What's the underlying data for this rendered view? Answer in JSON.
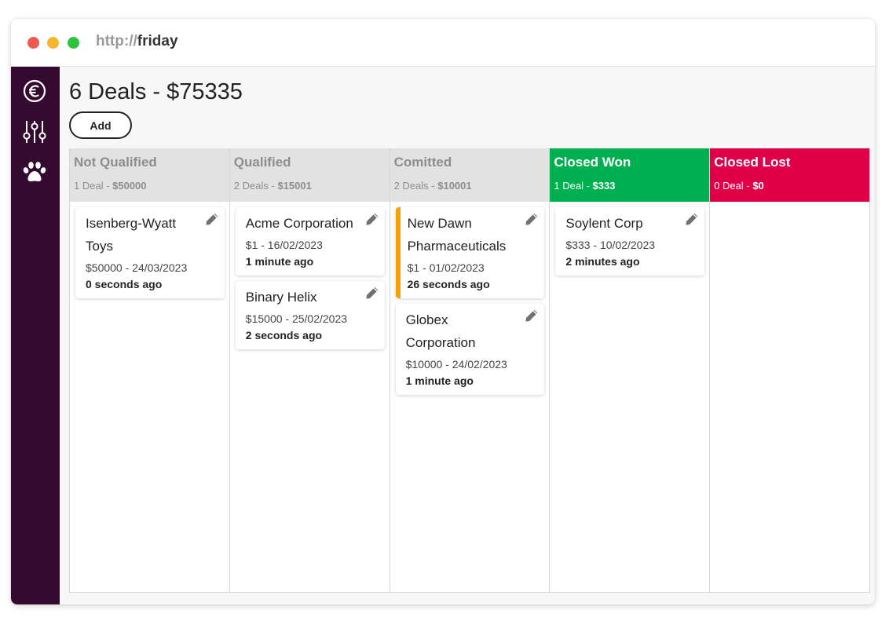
{
  "browser": {
    "url_protocol": "http://",
    "url_host": "friday"
  },
  "sidebar": {
    "items": [
      {
        "icon": "euro-icon"
      },
      {
        "icon": "sliders-icon"
      },
      {
        "icon": "paw-icon"
      }
    ]
  },
  "header": {
    "title": "6 Deals - $75335",
    "add_label": "Add"
  },
  "colors": {
    "won": "#00b050",
    "lost": "#e0004a",
    "flag": "#f5a300",
    "sidebar": "#350a31"
  },
  "columns": [
    {
      "title": "Not Qualified",
      "count_label": "1 Deal",
      "separator": " - ",
      "total": "$50000",
      "cards": [
        {
          "name": "Isenberg-Wyatt Toys",
          "meta": "$50000 - 24/03/2023",
          "time": "0 seconds ago"
        }
      ]
    },
    {
      "title": "Qualified",
      "count_label": "2 Deals",
      "separator": " - ",
      "total": "$15001",
      "cards": [
        {
          "name": "Acme Corporation",
          "meta": "$1 - 16/02/2023",
          "time": "1 minute ago"
        },
        {
          "name": "Binary Helix",
          "meta": "$15000 - 25/02/2023",
          "time": "2 seconds ago"
        }
      ]
    },
    {
      "title": "Comitted",
      "count_label": "2 Deals",
      "separator": " - ",
      "total": "$10001",
      "cards": [
        {
          "name": "New Dawn Pharmaceuticals",
          "meta": "$1 - 01/02/2023",
          "time": "26 seconds ago"
        },
        {
          "name": "Globex Corporation",
          "meta": "$10000 - 24/02/2023",
          "time": "1 minute ago"
        }
      ]
    },
    {
      "title": "Closed Won",
      "count_label": "1 Deal",
      "separator": " - ",
      "total": "$333",
      "cards": [
        {
          "name": "Soylent Corp",
          "meta": "$333 - 10/02/2023",
          "time": "2 minutes ago"
        }
      ]
    },
    {
      "title": "Closed Lost",
      "count_label": "0 Deal",
      "separator": " - ",
      "total": "$0",
      "cards": []
    }
  ]
}
